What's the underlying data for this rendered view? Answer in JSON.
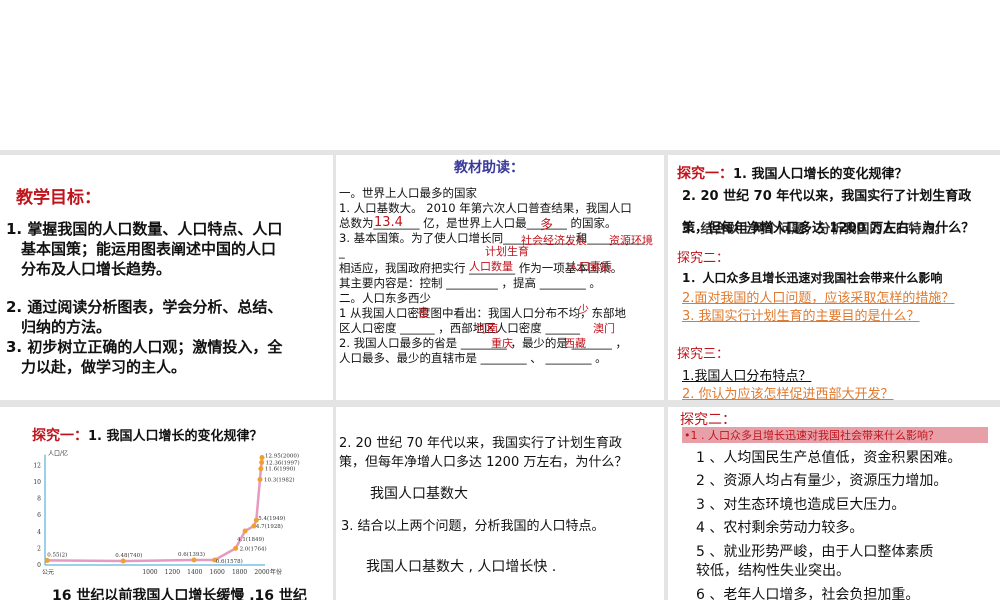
{
  "slide1": {
    "title": "教学目标：",
    "goals": [
      [
        "1. 掌握我国的人口数量、人口特点、人口",
        "　基本国策；能运用图表阐述中国的人口",
        "　分布及人口增长趋势。"
      ],
      [
        "2. 通过阅读分析图表，学会分析、总结、",
        "　归纳的方法。"
      ],
      [
        "3. 初步树立正确的人口观；激情投入，全",
        "　力以赴，做学习的主人。"
      ]
    ]
  },
  "slide2": {
    "title": "教材助读：",
    "lines": [
      "一。世界上人口最多的国家",
      "1. 人口基数大。 2010 年第六次人口普查结果，我国人口",
      "总数为________ 亿，是世界上人口最_______ 的国家。",
      "3. 基本国策。为了使人口增长同____________ 和__________",
      "_",
      "相适应，我国政府把实行 ________ 作为一项基本国策。",
      "其主要内容是：控制 _________ ，提高 ________ 。",
      "二。人口东多西少",
      "1 从我国人口密度图中看出：我国人口分布不均，东部地",
      "区人口密度 ______ ，西部地区人口密度 ______",
      "2. 我国人口最多的省是 ________ ，最少的是 _______ ，",
      "人口最多、最少的直辖市是 ________ 、 ________ 。"
    ],
    "answers": {
      "total": "13.4",
      "most": "多",
      "econ": "社会经济发展",
      "env": "资源环境",
      "plan": "计划生育",
      "qty": "人口数量",
      "quality": "人口素质",
      "dense": "密",
      "sparse": "少",
      "henan": "河南",
      "xizang": "西藏",
      "chongqing": "重庆",
      "macau": "澳门"
    }
  },
  "slide3": {
    "q1_label": "探究一：",
    "q1": "1. 我国人口增长的变化规律？",
    "q2": "2.  20 世纪 70 年代以来，我国实行了计划生育政",
    "q2b": "策，但每年净增人口多达 1200 万左右，为什么？",
    "q3": "3. 结合以上两个问题，分析我国的人口特点。",
    "q2_label": "探究二：",
    "e2": [
      "1．人口众多且增长迅速对我国社会带来什么影响",
      "2.面对我国的人口问题，应该采取怎样的措施？",
      "3. 我国实行计划生育的主要目的是什么？"
    ],
    "q3_label": "探究三：",
    "e3": [
      "1.我国人口分布特点？",
      "2. 你认为应该怎样促进西部大开发？"
    ]
  },
  "slide4": {
    "label": "探究一：",
    "question": "1. 我国人口增长的变化规律？",
    "caption": "16 世纪以前我国人口增长缓慢 .16 世纪"
  },
  "chart_data": {
    "type": "line",
    "ylabel": "人口/亿",
    "xlabel": "年份",
    "x_first_label": "公元",
    "yticks": [
      0,
      2,
      4,
      6,
      8,
      10,
      12
    ],
    "xticks": [
      1000,
      1200,
      1400,
      1600,
      1800,
      2000
    ],
    "points": [
      {
        "year": 2,
        "value": 0.55,
        "label": "0.55(2)"
      },
      {
        "year": 740,
        "value": 0.48,
        "label": "0.48(740)"
      },
      {
        "year": 1393,
        "value": 0.6,
        "label": "0.6(1393)"
      },
      {
        "year": 1578,
        "value": 0.6,
        "label": "0.6(1578)"
      },
      {
        "year": 1764,
        "value": 2.0,
        "label": "2.0(1764)"
      },
      {
        "year": 1849,
        "value": 4.1,
        "label": "4.1(1849)"
      },
      {
        "year": 1928,
        "value": 4.7,
        "label": "4.7(1928)"
      },
      {
        "year": 1949,
        "value": 5.4,
        "label": "5.4(1949)"
      },
      {
        "year": 1982,
        "value": 10.3,
        "label": "10.3(1982)"
      },
      {
        "year": 1990,
        "value": 11.6,
        "label": "11.6(1990)"
      },
      {
        "year": 1997,
        "value": 12.36,
        "label": "12.36(1997)"
      },
      {
        "year": 2000,
        "value": 12.95,
        "label": "12.95(2000)"
      }
    ],
    "colors": {
      "line": "#e79ac0",
      "point": "#f0a030"
    }
  },
  "slide5": {
    "q2": "2.  20 世纪 70 年代以来，我国实行了计划生育政",
    "q2b": "策，但每年净增人口多达 1200 万左右，为什么？",
    "a2": "我国人口基数大",
    "q3": "3. 结合以上两个问题，分析我国的人口特点。",
    "a3": "我国人口基数大 , 人口增长快 ."
  },
  "slide6": {
    "label": "探究二：",
    "question": "•1 . 人口众多且增长迅速对我国社会带来什么影响？",
    "items": [
      "1 、人均国民生产总值低，资金积累困难。",
      "2 、资源人均占有量少，资源压力增加。",
      "3 、对生态环境也造成巨大压力。",
      "4 、农村剩余劳动力较多。",
      "5 、就业形势严峻，由于人口整体素质",
      "较低，结构性失业突出。",
      "6 、老年人口增多，社会负担加重。"
    ]
  }
}
